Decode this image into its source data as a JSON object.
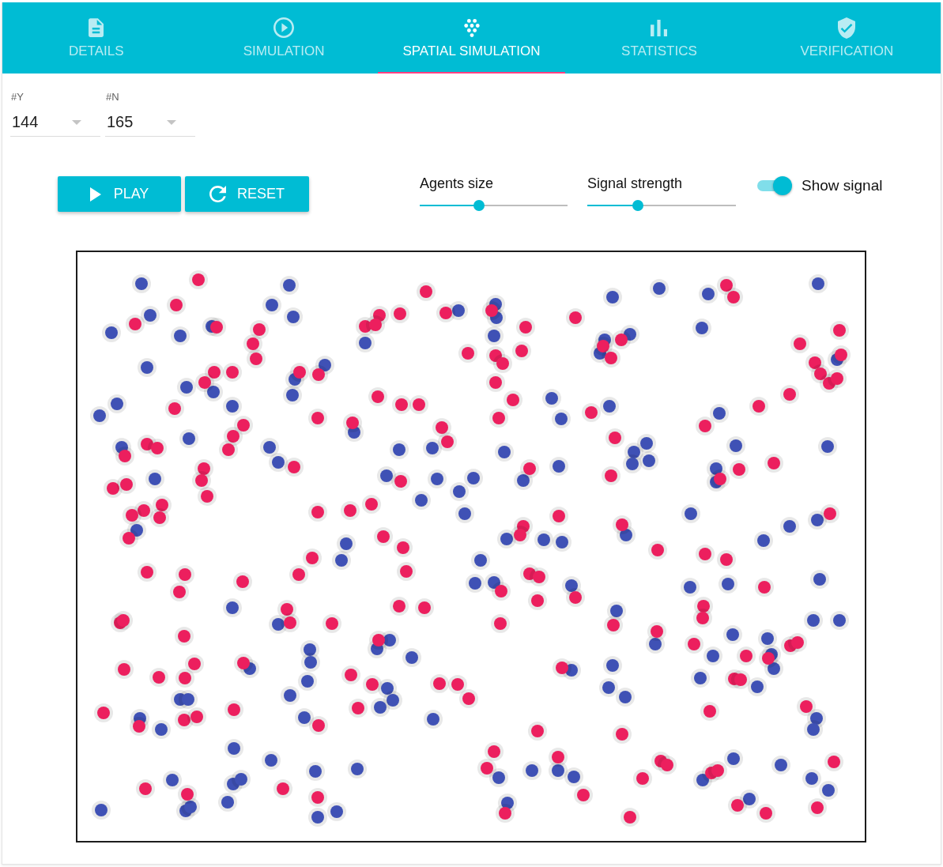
{
  "tabs": [
    {
      "label": "DETAILS",
      "selected": false
    },
    {
      "label": "SIMULATION",
      "selected": false
    },
    {
      "label": "SPATIAL SIMULATION",
      "selected": true
    },
    {
      "label": "STATISTICS",
      "selected": false
    },
    {
      "label": "VERIFICATION",
      "selected": false
    }
  ],
  "selectors": [
    {
      "label": "#Y",
      "value": "144"
    },
    {
      "label": "#N",
      "value": "165"
    }
  ],
  "buttons": [
    {
      "label": "PLAY"
    },
    {
      "label": "RESET"
    }
  ],
  "sliders": [
    {
      "label": "Agents size",
      "level": 0.4
    },
    {
      "label": "Signal strength",
      "level": 0.34
    }
  ],
  "show_signal": {
    "label": "Show signal",
    "on": true
  }
}
